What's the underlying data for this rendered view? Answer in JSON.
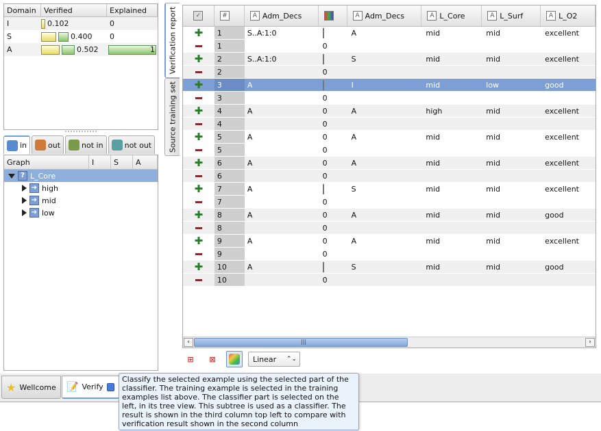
{
  "summary": {
    "headers": [
      "Domain",
      "Verified",
      "Explained"
    ],
    "rows": [
      {
        "domain": "I",
        "verified": "0.102",
        "verified_frac": 0.102,
        "explained": "0"
      },
      {
        "domain": "S",
        "verified": "0.400",
        "verified_frac": 0.4,
        "explained": "0"
      },
      {
        "domain": "A",
        "verified": "0.502",
        "verified_frac": 0.502,
        "explained": "1"
      }
    ]
  },
  "left_tabs": [
    {
      "label": "in",
      "icon": "tree-in-icon"
    },
    {
      "label": "out",
      "icon": "tree-out-icon"
    },
    {
      "label": "not in",
      "icon": "tree-not-in-icon"
    },
    {
      "label": "not out",
      "icon": "tree-not-out-icon"
    }
  ],
  "tree": {
    "headers": [
      "Graph",
      "I",
      "S",
      "A"
    ],
    "root": "L_Core",
    "children": [
      "high",
      "mid",
      "low"
    ]
  },
  "vertical_tabs": [
    "Verification report",
    "Source training set"
  ],
  "grid": {
    "headers": [
      "",
      "#",
      "Adm_Decs",
      "",
      "Adm_Decs",
      "L_Core",
      "L_Surf",
      "L_O2"
    ],
    "rows": [
      {
        "sign": "+",
        "n": "1",
        "a": "S..A:1:0",
        "box": "green",
        "v": "",
        "b": "A",
        "c": "mid",
        "d": "mid",
        "e": "excellent"
      },
      {
        "sign": "-",
        "n": "1",
        "a": "",
        "box": "",
        "v": "0",
        "b": "",
        "c": "",
        "d": "",
        "e": ""
      },
      {
        "sign": "+",
        "n": "2",
        "a": "S..A:1:0",
        "box": "green",
        "v": "",
        "b": "S",
        "c": "mid",
        "d": "mid",
        "e": "excellent"
      },
      {
        "sign": "-",
        "n": "2",
        "a": "",
        "box": "",
        "v": "0",
        "b": "",
        "c": "",
        "d": "",
        "e": ""
      },
      {
        "sign": "+",
        "n": "3",
        "a": "A",
        "box": "yellow",
        "v": "",
        "b": "I",
        "c": "mid",
        "d": "low",
        "e": "good",
        "selected": true
      },
      {
        "sign": "-",
        "n": "3",
        "a": "",
        "box": "",
        "v": "0",
        "b": "",
        "c": "",
        "d": "",
        "e": ""
      },
      {
        "sign": "+",
        "n": "4",
        "a": "A",
        "box": "",
        "v": "0",
        "b": "A",
        "c": "high",
        "d": "mid",
        "e": "excellent"
      },
      {
        "sign": "-",
        "n": "4",
        "a": "",
        "box": "",
        "v": "0",
        "b": "",
        "c": "",
        "d": "",
        "e": ""
      },
      {
        "sign": "+",
        "n": "5",
        "a": "A",
        "box": "",
        "v": "0",
        "b": "A",
        "c": "mid",
        "d": "mid",
        "e": "excellent"
      },
      {
        "sign": "-",
        "n": "5",
        "a": "",
        "box": "",
        "v": "0",
        "b": "",
        "c": "",
        "d": "",
        "e": ""
      },
      {
        "sign": "+",
        "n": "6",
        "a": "A",
        "box": "",
        "v": "0",
        "b": "A",
        "c": "mid",
        "d": "mid",
        "e": "excellent"
      },
      {
        "sign": "-",
        "n": "6",
        "a": "",
        "box": "",
        "v": "0",
        "b": "",
        "c": "",
        "d": "",
        "e": ""
      },
      {
        "sign": "+",
        "n": "7",
        "a": "A",
        "box": "yellow",
        "v": "",
        "b": "S",
        "c": "mid",
        "d": "mid",
        "e": "excellent"
      },
      {
        "sign": "-",
        "n": "7",
        "a": "",
        "box": "",
        "v": "0",
        "b": "",
        "c": "",
        "d": "",
        "e": ""
      },
      {
        "sign": "+",
        "n": "8",
        "a": "A",
        "box": "",
        "v": "0",
        "b": "A",
        "c": "mid",
        "d": "mid",
        "e": "good"
      },
      {
        "sign": "-",
        "n": "8",
        "a": "",
        "box": "",
        "v": "0",
        "b": "",
        "c": "",
        "d": "",
        "e": ""
      },
      {
        "sign": "+",
        "n": "9",
        "a": "A",
        "box": "",
        "v": "0",
        "b": "A",
        "c": "mid",
        "d": "mid",
        "e": "excellent"
      },
      {
        "sign": "-",
        "n": "9",
        "a": "",
        "box": "",
        "v": "0",
        "b": "",
        "c": "",
        "d": "",
        "e": ""
      },
      {
        "sign": "+",
        "n": "10",
        "a": "A",
        "box": "yellow",
        "v": "",
        "b": "S",
        "c": "mid",
        "d": "mid",
        "e": "good"
      },
      {
        "sign": "-",
        "n": "10",
        "a": "",
        "box": "",
        "v": "0",
        "b": "",
        "c": "",
        "d": "",
        "e": ""
      }
    ]
  },
  "toolbar": {
    "select_value": "Linear"
  },
  "bottom_tabs": [
    {
      "label": "Wellcome",
      "icon": "star-icon"
    },
    {
      "label": "Verify",
      "icon": "notepad-icon"
    }
  ],
  "tooltip": "Classify the selected example using the selected part of the classifier. The training example is selected in the training examples list above. The classifier part is selected on the left, in its tree view. This subtree is used as a classifier. The result is shown in the third column top left to compare with verification result shown in the second column",
  "colors": {
    "selection": "#7e9ed6",
    "accent": "#6fa0d8"
  }
}
